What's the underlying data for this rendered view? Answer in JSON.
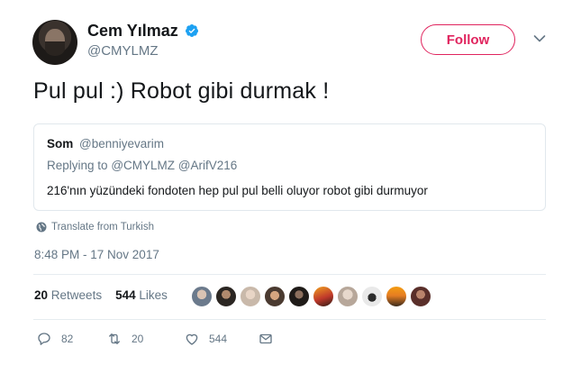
{
  "author": {
    "name": "Cem Yılmaz",
    "handle": "@CMYLMZ",
    "verified": true
  },
  "follow_label": "Follow",
  "tweet_text": "Pul pul :) Robot gibi durmak !",
  "quoted": {
    "name": "Som",
    "handle": "@benniyevarim",
    "replying_label": "Replying to",
    "reply_mentions": "@CMYLMZ @ArifV216",
    "text": "216'nın yüzündeki fondoten hep pul pul belli oluyor robot gibi durmuyor"
  },
  "translate_label": "Translate from Turkish",
  "timestamp": "8:48 PM - 17 Nov 2017",
  "stats": {
    "retweets_count": "20",
    "retweets_label": "Retweets",
    "likes_count": "544",
    "likes_label": "Likes"
  },
  "liker_avatars": 10,
  "actions": {
    "replies": "82",
    "retweets": "20",
    "likes": "544"
  },
  "colors": {
    "follow_accent": "#e0245e",
    "verified_blue": "#1da1f2",
    "secondary_text": "#657786"
  }
}
